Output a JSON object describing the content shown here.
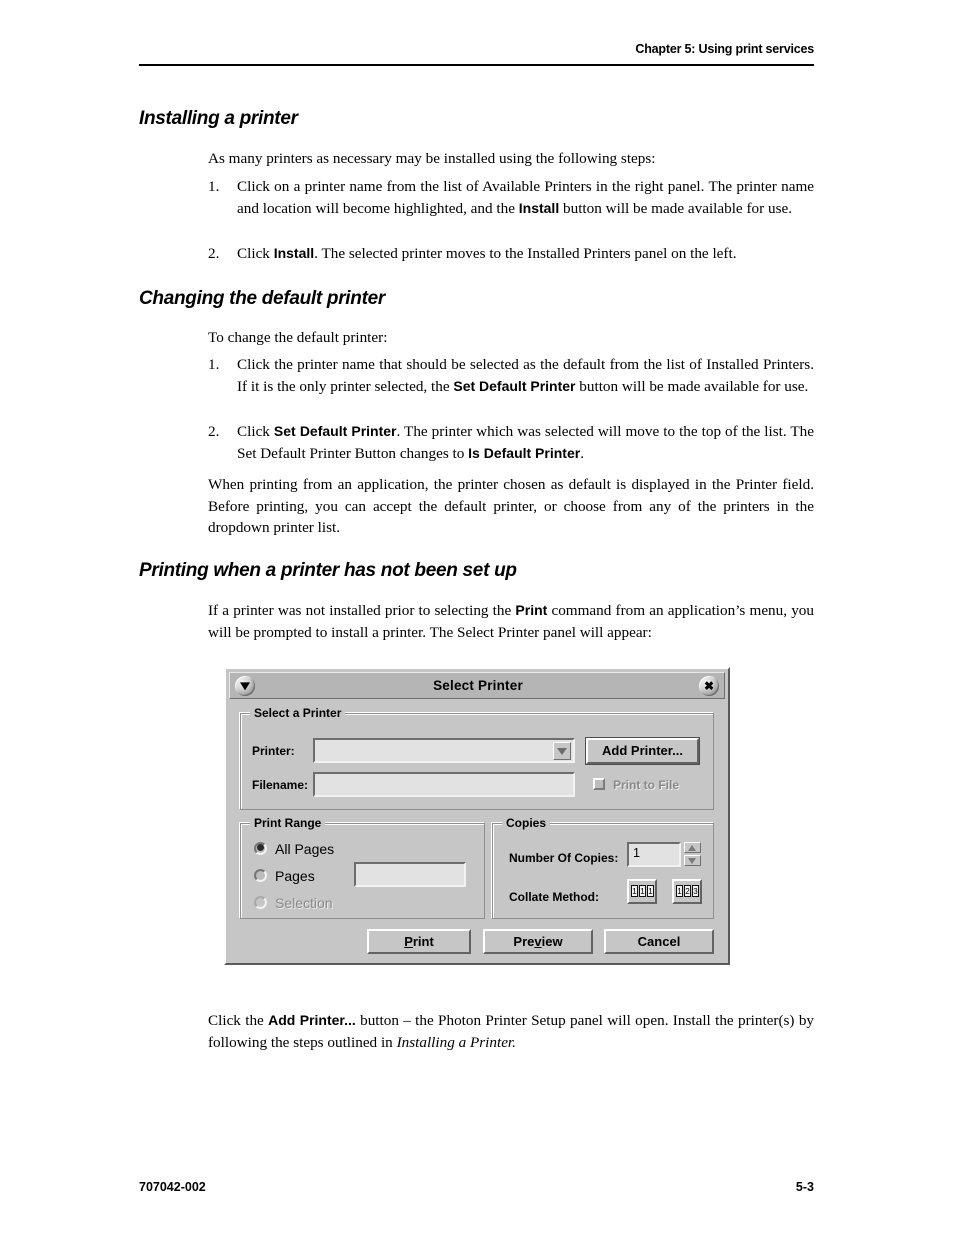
{
  "header": {
    "chapter": "Chapter 5: Using print services"
  },
  "footer": {
    "doc_number": "707042-002",
    "page_number": "5-3"
  },
  "sections": [
    {
      "heading": "Installing a printer",
      "intro": "As many printers as necessary may be installed using the following steps:",
      "steps": [
        {
          "num": "1.",
          "parts": [
            {
              "t": "Click on a printer name from the list of Available Printers in the right panel. The printer name and location will become highlighted, and the ",
              "b": false
            },
            {
              "t": "Install",
              "b": true
            },
            {
              "t": " button will be made available for use.",
              "b": false
            }
          ]
        },
        {
          "num": "2.",
          "parts": [
            {
              "t": "Click ",
              "b": false
            },
            {
              "t": "Install",
              "b": true
            },
            {
              "t": ". The selected printer moves to the Installed Printers panel on the left.",
              "b": false
            }
          ]
        }
      ]
    },
    {
      "heading": "Changing the default printer",
      "intro": "To change the default printer:",
      "steps": [
        {
          "num": "1.",
          "parts": [
            {
              "t": "Click the printer name that should be selected as the default from the list of Installed Printers. If it is the only printer selected, the ",
              "b": false
            },
            {
              "t": "Set Default Printer",
              "b": true
            },
            {
              "t": " button will be made available for use.",
              "b": false
            }
          ]
        },
        {
          "num": "2.",
          "parts": [
            {
              "t": "Click ",
              "b": false
            },
            {
              "t": "Set Default Printer",
              "b": true
            },
            {
              "t": ". The printer which was selected will move to the top of the list. The Set Default Printer Button changes to ",
              "b": false
            },
            {
              "t": "Is Default Printer",
              "b": true
            },
            {
              "t": ".",
              "b": false
            }
          ]
        }
      ],
      "closing": [
        {
          "t": "When printing from an application, the printer chosen as default is displayed in the Printer field. Before printing, you can accept the default printer, or choose from any of the printers in the dropdown printer list.",
          "b": false
        }
      ]
    },
    {
      "heading": "Printing when a printer has not been set up",
      "intro_parts": [
        {
          "t": "If a printer was not installed prior to selecting the ",
          "b": false
        },
        {
          "t": "Print",
          "b": true
        },
        {
          "t": " command from an application’s menu, you will be prompted to install a printer. The Select Printer panel will appear:",
          "b": false
        }
      ],
      "after_figure_parts": [
        {
          "t": "Click the ",
          "b": false
        },
        {
          "t": "Add Printer...",
          "b": true
        },
        {
          "t": " button – the Photon Printer Setup panel will open. Install the printer(s) by following the steps outlined in ",
          "b": false
        },
        {
          "t": "Installing a Printer.",
          "b": false,
          "i": true
        }
      ]
    }
  ],
  "dialog": {
    "title": "Select Printer",
    "window_menu_icon": "triangle-down-icon",
    "close_icon": "close-x-icon",
    "select_printer_group": {
      "label": "Select a Printer",
      "printer_label": "Printer:",
      "printer_value": "",
      "printer_dropdown_icon": "chevron-down-icon",
      "add_printer_button": "Add Printer...",
      "filename_label": "Filename:",
      "filename_value": "",
      "print_to_file_label": "Print to File",
      "print_to_file_checked": false,
      "print_to_file_enabled": false
    },
    "print_range_group": {
      "label": "Print Range",
      "options": [
        {
          "label": "All Pages",
          "selected": true,
          "enabled": true
        },
        {
          "label": "Pages",
          "selected": false,
          "enabled": true
        },
        {
          "label": "Selection",
          "selected": false,
          "enabled": false
        }
      ],
      "pages_value": ""
    },
    "copies_group": {
      "label": "Copies",
      "number_label": "Number Of Copies:",
      "number_value": "1",
      "spinner_up_icon": "triangle-up-icon",
      "spinner_down_icon": "triangle-down-icon",
      "collate_label": "Collate Method:",
      "collate_uncollated_pages": [
        "1",
        "1",
        "1"
      ],
      "collate_collated_pages": [
        "1",
        "2",
        "3"
      ]
    },
    "buttons": {
      "print": "Print",
      "print_mnemonic": "P",
      "preview": "Preview",
      "preview_mnemonic": "v",
      "cancel": "Cancel"
    }
  },
  "colors": {
    "dialog_face": "#c6c6c6",
    "titlebar": "#b5b5b5",
    "field": "#e2e2e2",
    "disabled_text": "#8a8a8a",
    "text": "#000000"
  }
}
